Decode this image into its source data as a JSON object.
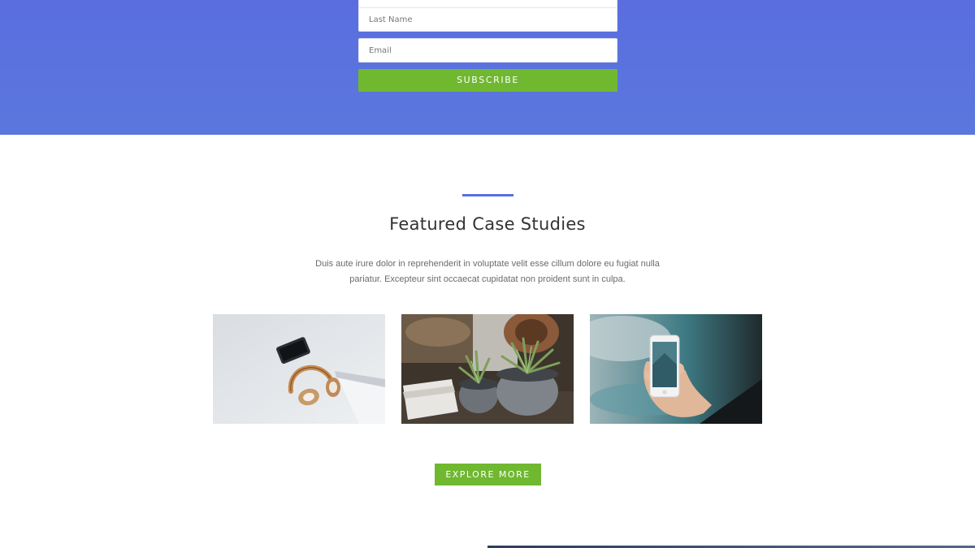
{
  "subscribe": {
    "last_name_placeholder": "Last Name",
    "email_placeholder": "Email",
    "button_label": "SUBSCRIBE"
  },
  "featured": {
    "title": "Featured Case Studies",
    "description": "Duis aute irure dolor in reprehenderit in voluptate velit esse cillum dolore eu fugiat nulla pariatur. Excepteur sint occaecat cupidatat non proident sunt in culpa.",
    "button_label": "EXPLORE MORE",
    "case_studies": [
      {
        "image": "headphones-and-phone-photo"
      },
      {
        "image": "potted-succulents-photo"
      },
      {
        "image": "hand-holding-smartphone-photo"
      }
    ]
  },
  "colors": {
    "hero_background": "#5a6edf",
    "accent_green": "#6fb830",
    "divider_blue": "#5a6edf"
  }
}
